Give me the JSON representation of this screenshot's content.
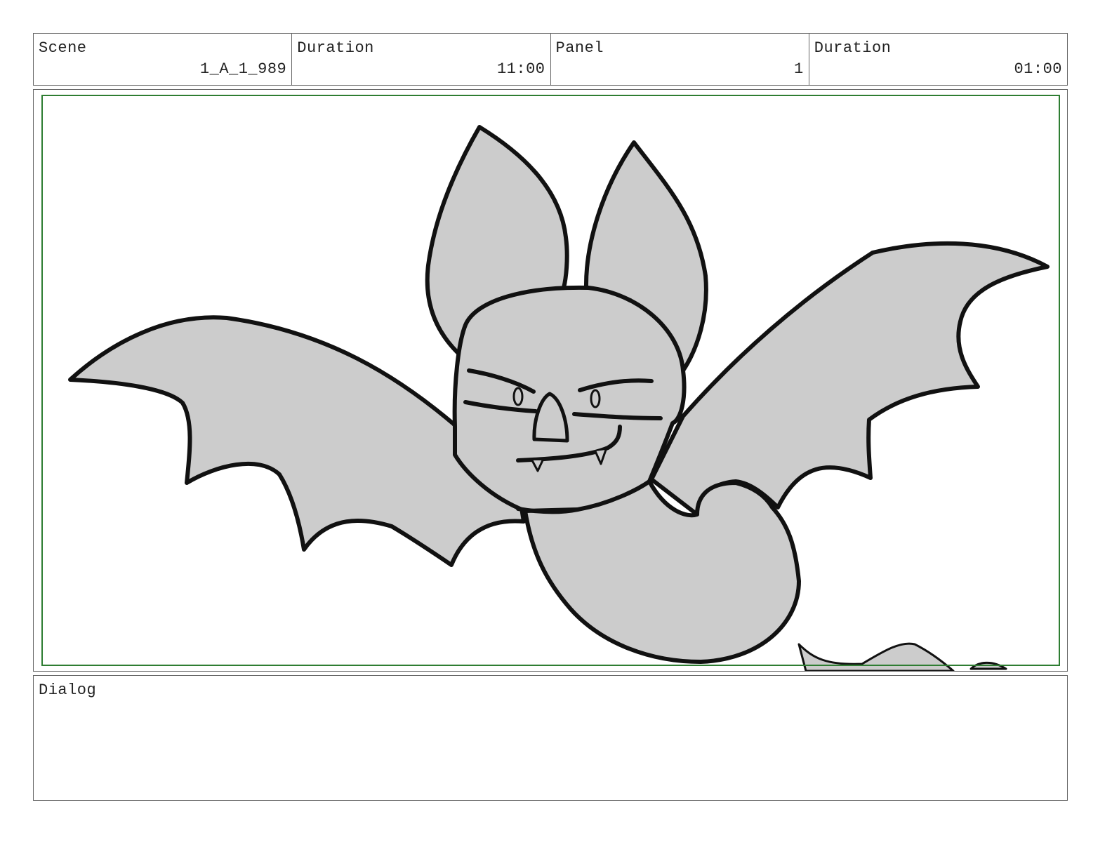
{
  "header": {
    "cells": [
      {
        "label": "Scene",
        "value": "1_A_1_989"
      },
      {
        "label": "Duration",
        "value": "11:00"
      },
      {
        "label": "Panel",
        "value": "1"
      },
      {
        "label": "Duration",
        "value": "01:00"
      }
    ]
  },
  "dialog": {
    "label": "Dialog",
    "text": ""
  },
  "colors": {
    "border": "#666666",
    "safe_frame": "#2e7d32",
    "bat_fill": "#cccccc",
    "ink": "#111111"
  }
}
